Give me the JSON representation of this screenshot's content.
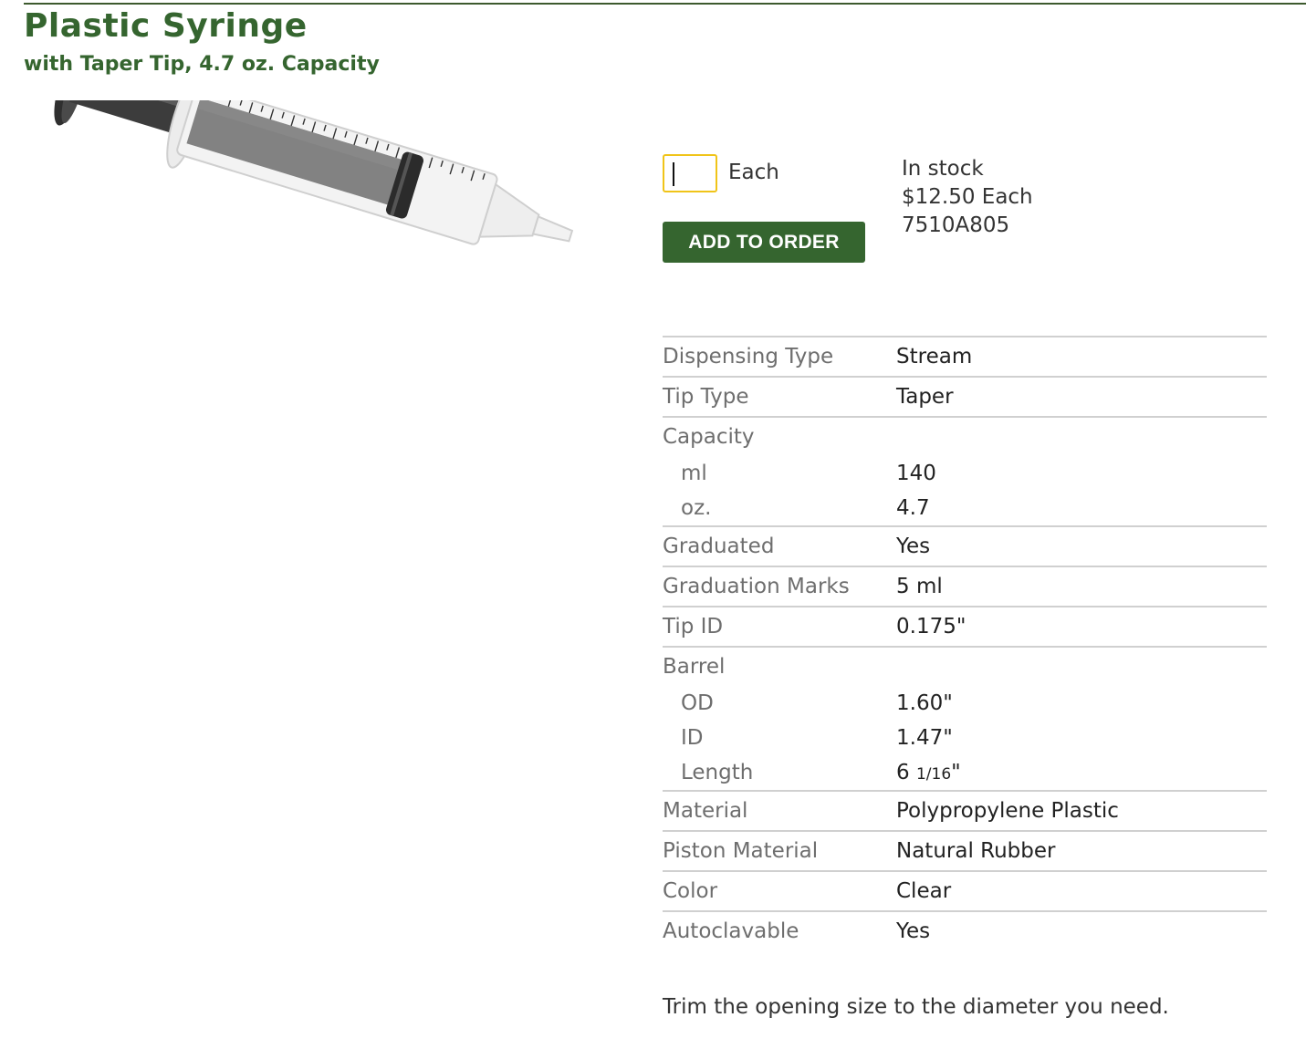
{
  "product": {
    "title": "Plastic Syringe",
    "subtitle": "with Taper Tip, 4.7 oz. Capacity",
    "image_alt": "plastic syringe with taper tip"
  },
  "order": {
    "quantity_value": "",
    "unit_label": "Each",
    "add_button_label": "ADD TO ORDER",
    "stock_status": "In stock",
    "price": "$12.50 Each",
    "part_number": "7510A805"
  },
  "specs": {
    "dispensing_type": {
      "label": "Dispensing Type",
      "value": "Stream"
    },
    "tip_type": {
      "label": "Tip Type",
      "value": "Taper"
    },
    "capacity": {
      "label": "Capacity",
      "ml": {
        "label": "ml",
        "value": "140"
      },
      "oz": {
        "label": "oz.",
        "value": "4.7"
      }
    },
    "graduated": {
      "label": "Graduated",
      "value": "Yes"
    },
    "graduation_marks": {
      "label": "Graduation Marks",
      "value": "5 ml"
    },
    "tip_id": {
      "label": "Tip ID",
      "value": "0.175\""
    },
    "barrel": {
      "label": "Barrel",
      "od": {
        "label": "OD",
        "value": "1.60\""
      },
      "id": {
        "label": "ID",
        "value": "1.47\""
      },
      "length": {
        "label": "Length",
        "whole": "6",
        "fraction": "1/16",
        "unit": "\""
      }
    },
    "material": {
      "label": "Material",
      "value": "Polypropylene Plastic"
    },
    "piston_material": {
      "label": "Piston Material",
      "value": "Natural Rubber"
    },
    "color": {
      "label": "Color",
      "value": "Clear"
    },
    "autoclavable": {
      "label": "Autoclavable",
      "value": "Yes"
    }
  },
  "description": "Trim the opening size to the diameter you need.",
  "colors": {
    "brand_green": "#35652f",
    "input_focus": "#f0c419",
    "divider": "#d0d0d0",
    "label_gray": "#6e6e6e"
  }
}
